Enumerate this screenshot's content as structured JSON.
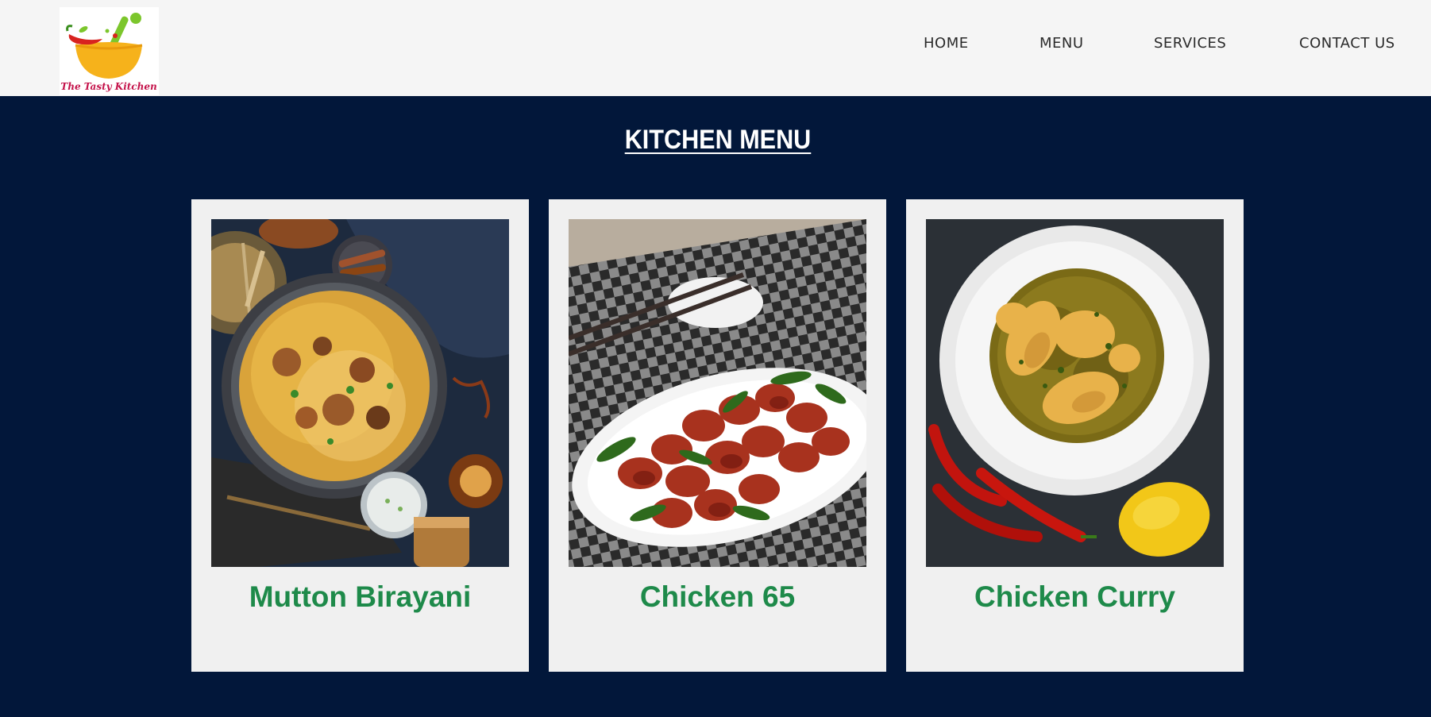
{
  "brand": {
    "logo_text": "The Tasty Kitchen"
  },
  "nav": {
    "items": [
      {
        "label": "HOME"
      },
      {
        "label": "MENU"
      },
      {
        "label": "SERVICES"
      },
      {
        "label": "CONTACT US"
      }
    ]
  },
  "menu": {
    "title": "KITCHEN MENU",
    "items": [
      {
        "name": "Mutton Birayani",
        "image": "mutton-biryani-image"
      },
      {
        "name": "Chicken 65",
        "image": "chicken-65-image"
      },
      {
        "name": "Chicken Curry",
        "image": "chicken-curry-image"
      }
    ]
  },
  "colors": {
    "background": "#02173a",
    "navbar": "#f5f5f5",
    "card": "#f0f0f0",
    "dish_name": "#1e8a4a"
  }
}
